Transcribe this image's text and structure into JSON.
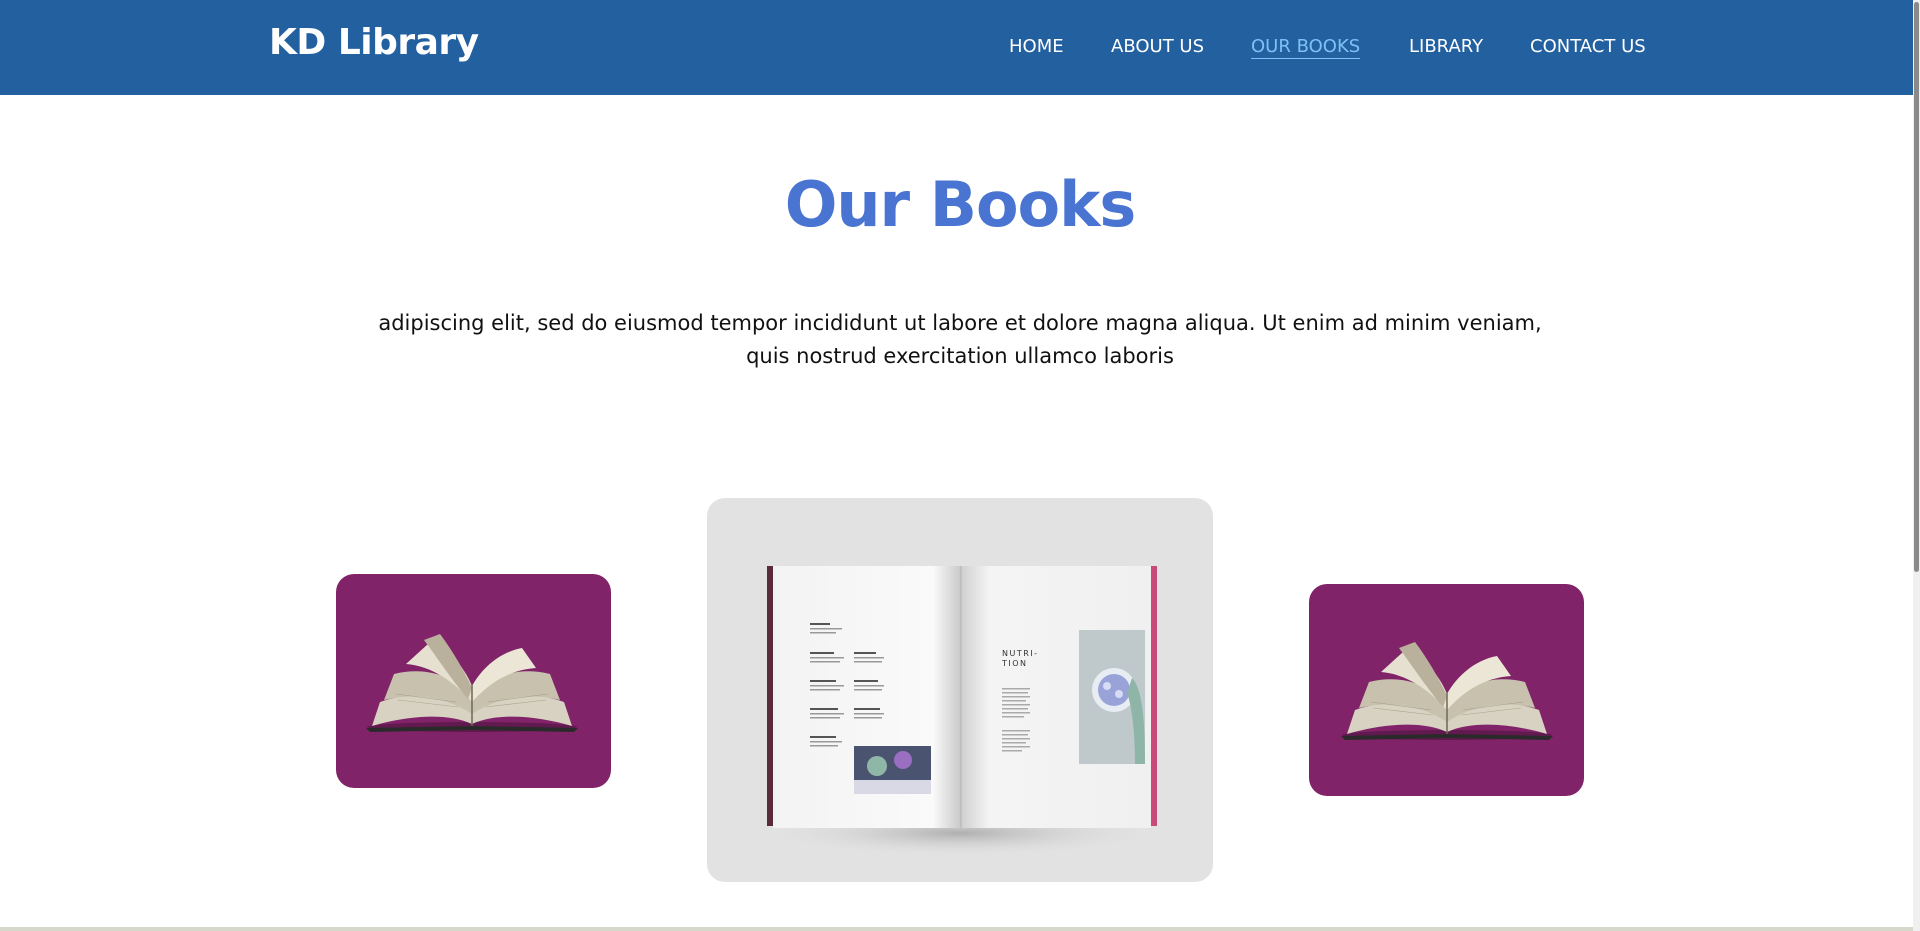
{
  "header": {
    "brand": "KD Library",
    "nav": [
      {
        "label": "HOME",
        "active": false
      },
      {
        "label": "ABOUT US",
        "active": false
      },
      {
        "label": "OUR BOOKS",
        "active": true
      },
      {
        "label": "LIBRARY",
        "active": false
      },
      {
        "label": "CONTACT US",
        "active": false
      }
    ]
  },
  "main": {
    "title": "Our Books",
    "intro": "adipiscing elit, sed do eiusmod tempor incididunt ut labore et dolore magna aliqua. Ut enim ad minim veniam, quis nostrud exercitation ullamco laboris",
    "magazine_heading": "NUTRI-\nTION"
  },
  "colors": {
    "navbar": "#2360a0",
    "heading": "#4a74d2",
    "active_nav": "#7ec0f5",
    "card_purple": "#812368",
    "card_grey": "#e2e2e2"
  }
}
